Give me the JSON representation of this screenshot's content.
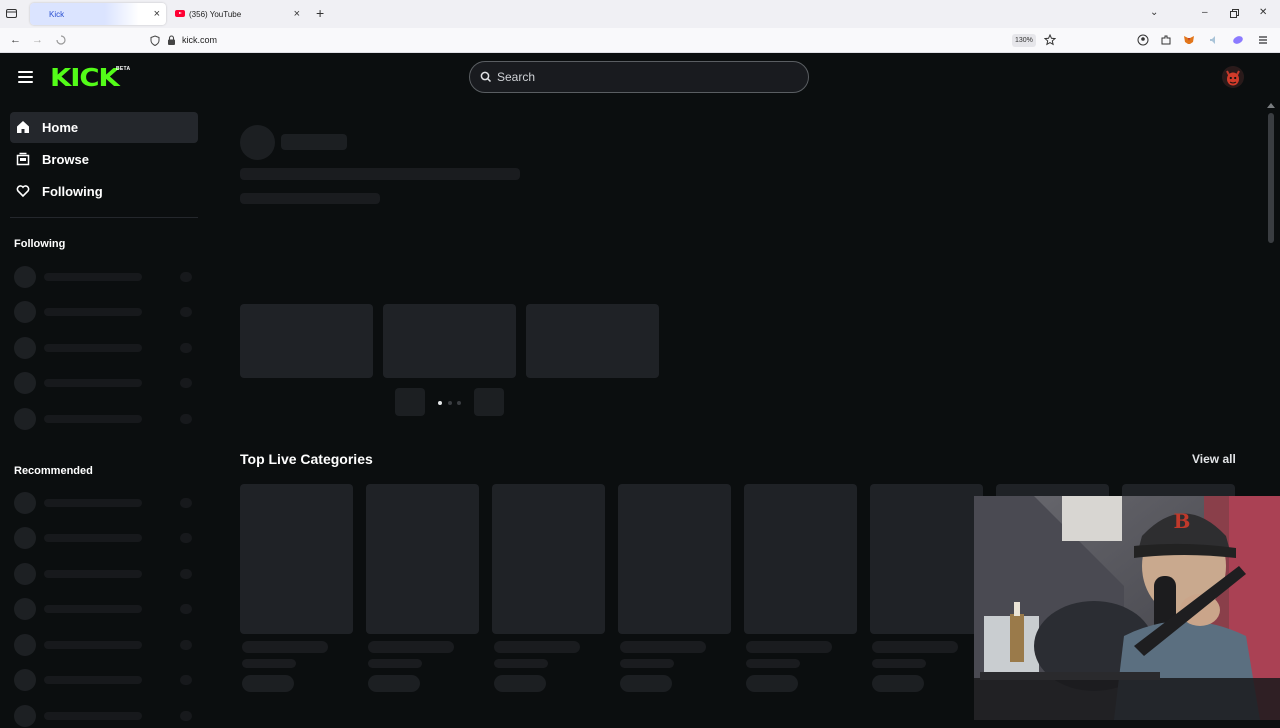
{
  "browser": {
    "tabs": [
      {
        "title": "Kick",
        "active": true
      },
      {
        "title": "(356) YouTube",
        "active": false
      }
    ],
    "url": "kick.com",
    "zoom": "130%"
  },
  "header": {
    "logo_text": "KICK",
    "beta_label": "BETA",
    "search_placeholder": "Search",
    "brand_color": "#53fc18"
  },
  "sidebar": {
    "nav": [
      {
        "label": "Home",
        "icon": "home-icon",
        "active": true
      },
      {
        "label": "Browse",
        "icon": "browse-icon",
        "active": false
      },
      {
        "label": "Following",
        "icon": "heart-icon",
        "active": false
      }
    ],
    "following_heading": "Following",
    "recommended_heading": "Recommended"
  },
  "main": {
    "carousel_page": 1,
    "carousel_pages": 3,
    "top_categories_title": "Top Live Categories",
    "view_all_label": "View all"
  }
}
